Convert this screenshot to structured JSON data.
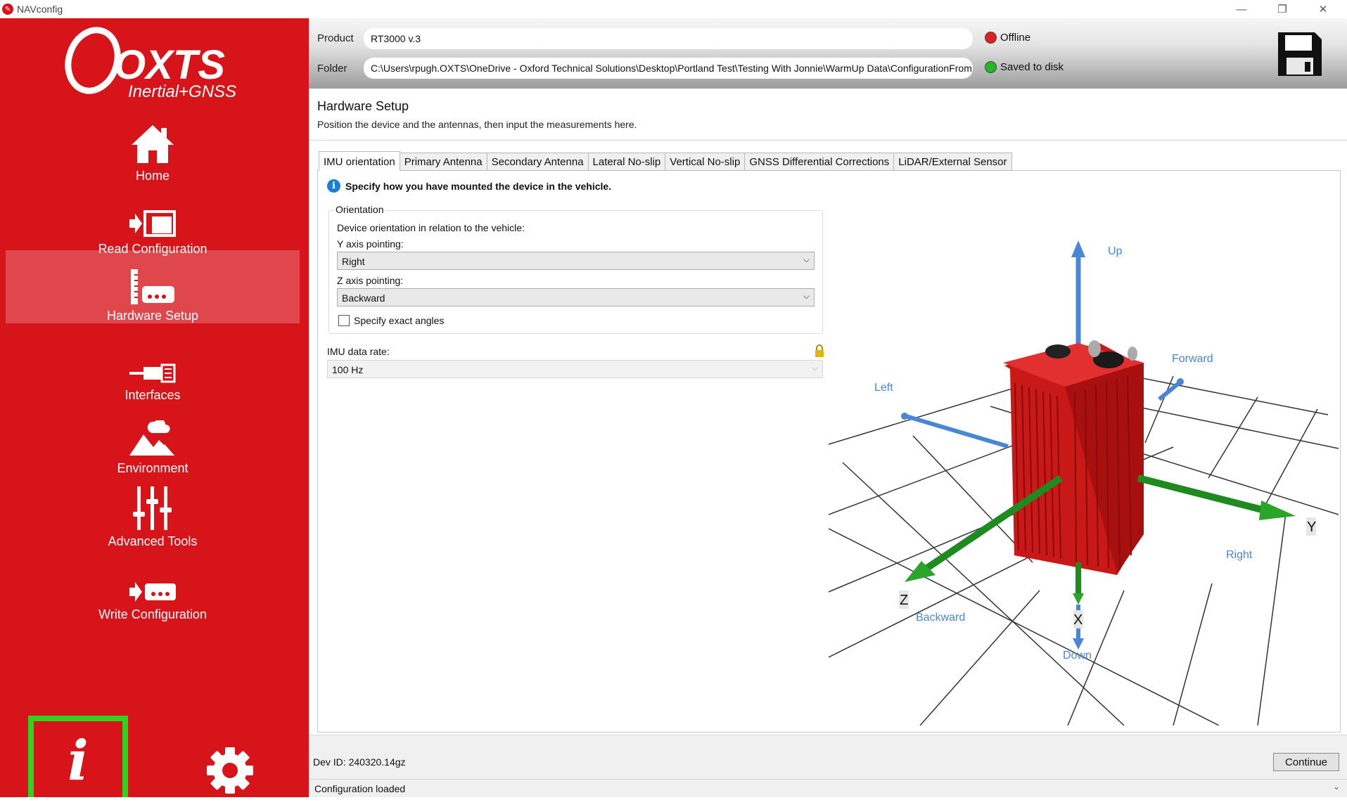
{
  "window": {
    "title": "NAVconfig",
    "minimize": "—",
    "restore": "❐",
    "close": "✕"
  },
  "logo": {
    "brand": "OXTS",
    "tagline": "Inertial+GNSS"
  },
  "sidebar": {
    "items": [
      {
        "label": "Home",
        "icon": "home-icon"
      },
      {
        "label": "Read Configuration",
        "icon": "read-configuration-icon"
      },
      {
        "label": "Hardware Setup",
        "icon": "hardware-setup-icon",
        "active": true
      },
      {
        "label": "Interfaces",
        "icon": "interfaces-icon"
      },
      {
        "label": "Environment",
        "icon": "environment-icon"
      },
      {
        "label": "Advanced Tools",
        "icon": "advanced-tools-icon"
      },
      {
        "label": "Write Configuration",
        "icon": "write-configuration-icon"
      }
    ],
    "info_glyph": "i",
    "accent_color": "#d7141a",
    "highlight_color": "#2fd31f"
  },
  "header": {
    "product_label": "Product",
    "product_value": "RT3000 v.3",
    "folder_label": "Folder",
    "folder_value": "C:\\Users\\rpugh.OXTS\\OneDrive - Oxford Technical Solutions\\Desktop\\Portland Test\\Testing With Jonnie\\WarmUp Data\\ConfigurationFromRawData",
    "connection_status": "Offline",
    "connection_color": "#e02020",
    "save_status": "Saved to disk",
    "save_color": "#22b822"
  },
  "page": {
    "title": "Hardware Setup",
    "description": "Position the device and the antennas, then input the measurements here."
  },
  "tabs": [
    {
      "label": "IMU orientation",
      "active": true
    },
    {
      "label": "Primary Antenna"
    },
    {
      "label": "Secondary Antenna"
    },
    {
      "label": "Lateral No-slip"
    },
    {
      "label": "Vertical No-slip"
    },
    {
      "label": "GNSS Differential Corrections"
    },
    {
      "label": "LiDAR/External Sensor"
    }
  ],
  "imu": {
    "hint_icon": "i",
    "hint": "Specify how you have mounted the device in the vehicle.",
    "group_title": "Orientation",
    "group_desc": "Device orientation in relation to the vehicle:",
    "y_label": "Y axis pointing:",
    "y_value": "Right",
    "z_label": "Z axis pointing:",
    "z_value": "Backward",
    "exact_angles_label": "Specify exact angles",
    "exact_angles_checked": false,
    "rate_label": "IMU data rate:",
    "rate_value": "100 Hz",
    "chevron": "⌵"
  },
  "scene": {
    "labels": {
      "up": "Up",
      "forward": "Forward",
      "left": "Left",
      "right": "Right",
      "backward": "Backward",
      "down": "Down",
      "y_axis": "Y",
      "z_axis": "Z",
      "x_axis": "X"
    },
    "colors": {
      "vehicle_axes": "#4a86d8",
      "device_axes": "#1f8a1f",
      "device_body": "#d01818",
      "label": "#4a86d8"
    }
  },
  "footer": {
    "dev_id": "Dev ID: 240320.14gz",
    "continue_label": "Continue",
    "status": "Configuration loaded",
    "status_chevron": "⌄"
  }
}
